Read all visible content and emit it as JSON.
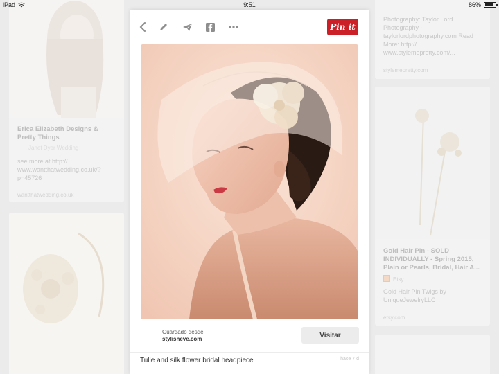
{
  "status_bar": {
    "device": "iPad",
    "time": "9:51",
    "battery_text": "86%",
    "battery_level": 0.86
  },
  "background_pins": {
    "left_top": {
      "title": "Erica Elizabeth Designs & Pretty Things",
      "subtitle": "Janet Dyer Wedding",
      "body": "see more at http:// www.wantthatwedding.co.uk/? p=45726",
      "footer": "wantthatwedding.co.uk"
    },
    "right_top": {
      "body": "Photography: Taylor Lord Photography - taylorlordphotography.com Read More: http:// www.stylemepretty.com/...",
      "footer": "stylemepretty.com"
    },
    "right_middle": {
      "title": "Gold Hair Pin - SOLD INDIVIDUALLY - Spring 2015, Plain or Pearls, Bridal, Hair A...",
      "shop": "Etsy",
      "body": "Gold Hair Pin Twigs by UniqueJewelryLLC",
      "footer": "etsy.com"
    }
  },
  "card": {
    "pin_it_label": "Pin it",
    "saved_from_label": "Guardado desde",
    "source_site": "stylisheve.com",
    "visit_label": "Visitar",
    "description": "Tulle and silk flower bridal headpiece",
    "description_meta": "hace 7 d"
  },
  "icons": {
    "back": "chevron-left-icon",
    "edit": "pencil-icon",
    "send": "paper-plane-icon",
    "share": "facebook-icon",
    "more": "more-dots-icon"
  },
  "colors": {
    "pin_it": "#cb2027",
    "visit_button_bg": "#ececec",
    "toolbar_icon": "#8e8e8e",
    "background_text": "#c8c8c8"
  }
}
